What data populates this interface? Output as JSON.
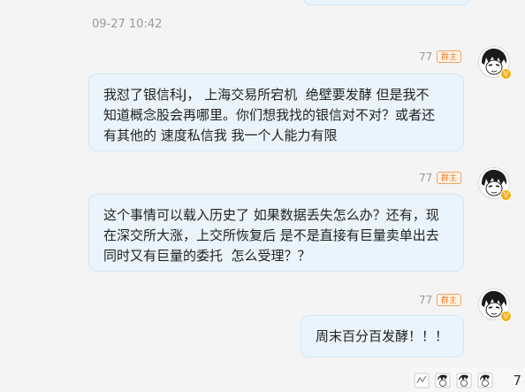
{
  "chat": {
    "timestamp": "09-27 10:42",
    "messages": [
      {
        "user_id": "77",
        "badge": "群主",
        "avatar_icon": "manga-face-avatar",
        "text": "我怼了银信科J， 上海交易所宕机  绝壁要发酵 但是我不\n知道概念股会再哪里。你们想我找的银信对不对？或者还\n有其他的 速度私信我 我一个人能力有限"
      },
      {
        "user_id": "77",
        "badge": "群主",
        "avatar_icon": "manga-face-avatar",
        "text": "这个事情可以载入历史了 如果数据丢失怎么办？还有，现\n在深交所大涨，上交所恢复后 是不是直接有巨量卖单出去\n同时又有巨量的委托  怎么受理？？"
      },
      {
        "user_id": "77",
        "badge": "群主",
        "avatar_icon": "manga-face-avatar",
        "text": "周末百分百发酵！！！"
      }
    ]
  },
  "footer": {
    "count": "7",
    "icons": [
      "thumb-icon",
      "avatar-icon",
      "avatar-icon",
      "avatar-icon"
    ]
  },
  "colors": {
    "bubble_bg": "#e9f4fc",
    "badge_orange": "#ee7c1f",
    "vip_gold": "#f6b21b"
  }
}
